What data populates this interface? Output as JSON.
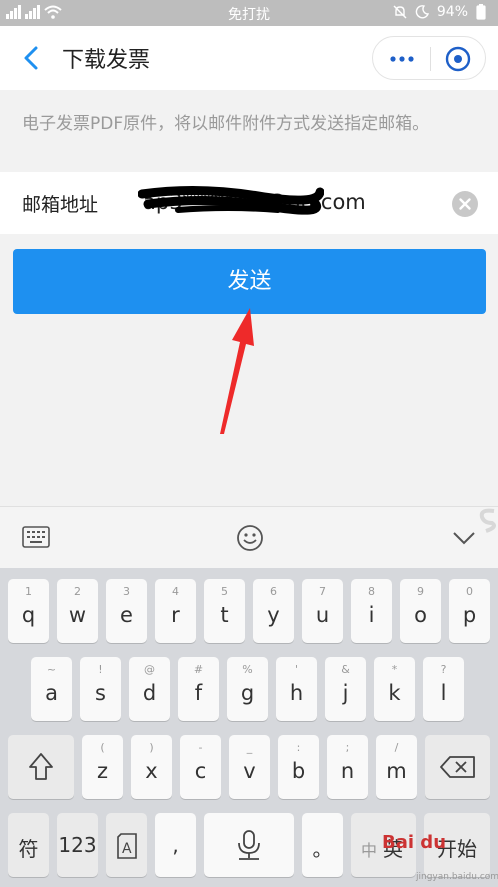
{
  "status_bar": {
    "center_text": "免打扰",
    "battery": "94%"
  },
  "header": {
    "title": "下载发票"
  },
  "hint_text": "电子发票PDF原件，将以邮件附件方式发送指定邮箱。",
  "email": {
    "label": "邮箱地址",
    "value": "ap3********@qq.com"
  },
  "send_label": "发送",
  "keyboard": {
    "row1": [
      {
        "hint": "1",
        "key": "q"
      },
      {
        "hint": "2",
        "key": "w"
      },
      {
        "hint": "3",
        "key": "e"
      },
      {
        "hint": "4",
        "key": "r"
      },
      {
        "hint": "5",
        "key": "t"
      },
      {
        "hint": "6",
        "key": "y"
      },
      {
        "hint": "7",
        "key": "u"
      },
      {
        "hint": "8",
        "key": "i"
      },
      {
        "hint": "9",
        "key": "o"
      },
      {
        "hint": "0",
        "key": "p"
      }
    ],
    "row2": [
      {
        "hint": "~",
        "key": "a"
      },
      {
        "hint": "!",
        "key": "s"
      },
      {
        "hint": "@",
        "key": "d"
      },
      {
        "hint": "#",
        "key": "f"
      },
      {
        "hint": "%",
        "key": "g"
      },
      {
        "hint": "'",
        "key": "h"
      },
      {
        "hint": "&",
        "key": "j"
      },
      {
        "hint": "*",
        "key": "k"
      },
      {
        "hint": "?",
        "key": "l"
      }
    ],
    "row3": [
      {
        "hint": "(",
        "key": "z"
      },
      {
        "hint": ")",
        "key": "x"
      },
      {
        "hint": "-",
        "key": "c"
      },
      {
        "hint": "_",
        "key": "v"
      },
      {
        "hint": ":",
        "key": "b"
      },
      {
        "hint": ";",
        "key": "n"
      },
      {
        "hint": "/",
        "key": "m"
      }
    ],
    "symbols_label": "符",
    "numbers_label": "123",
    "comma_label": ",",
    "period_label": "。",
    "lang_zh": "中",
    "lang_en": "英",
    "start_label": "开始"
  },
  "watermark": {
    "brand": "Bai du",
    "site": "jingyan.baidu.com"
  }
}
